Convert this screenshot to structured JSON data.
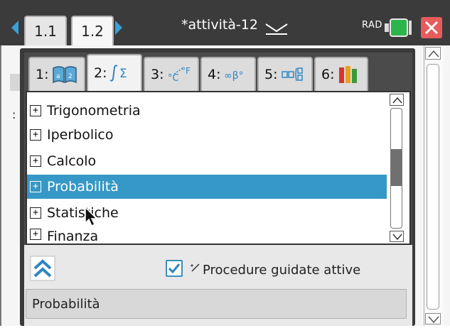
{
  "header": {
    "tabs": [
      {
        "label": "1.1"
      },
      {
        "label": "1.2"
      }
    ],
    "title": "*attività-12",
    "angle_mode": "RAD"
  },
  "background": {
    "partial_char": ":"
  },
  "catalog": {
    "tabs": [
      {
        "label": "1:",
        "icon": "book-icon"
      },
      {
        "label": "2:",
        "icon": "integral-sigma-icon"
      },
      {
        "label": "3:",
        "icon": "unit-conversion-icon"
      },
      {
        "label": "4:",
        "icon": "symbols-icon"
      },
      {
        "label": "5:",
        "icon": "templates-icon"
      },
      {
        "label": "6:",
        "icon": "library-icon"
      }
    ],
    "items": [
      {
        "label": "Trigonometria"
      },
      {
        "label": "Iperbolico"
      },
      {
        "label": "Calcolo"
      },
      {
        "label": "Probabilità",
        "selected": true
      },
      {
        "label": "Statistiche"
      },
      {
        "label": "Finanza"
      }
    ],
    "guided_label": "Procedure guidate attive",
    "guided_checked": true,
    "description": "Probabilità"
  },
  "colors": {
    "selection": "#3598c6",
    "accent": "#3aa0d8",
    "close": "#e65b5b"
  }
}
